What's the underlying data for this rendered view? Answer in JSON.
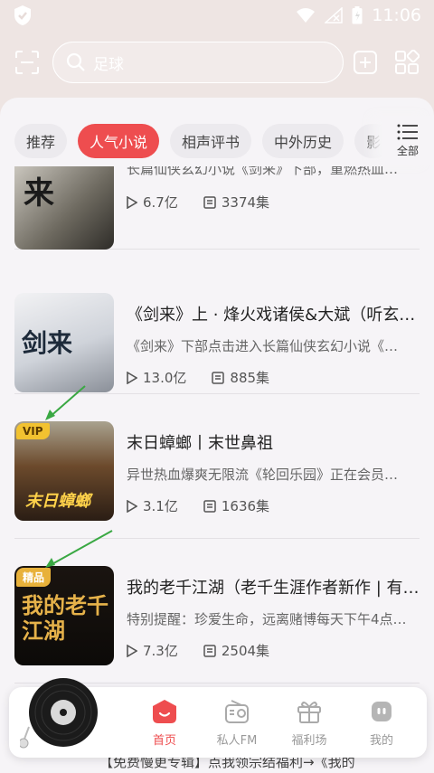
{
  "status": {
    "time": "11:06"
  },
  "search": {
    "placeholder": "足球"
  },
  "tabs": [
    "推荐",
    "人气小说",
    "相声评书",
    "中外历史",
    "影"
  ],
  "tab_all_label": "全部",
  "items": [
    {
      "title": "",
      "desc": "长篇仙侠玄幻小说《剑来》下部，重燃热血…",
      "plays": "6.7亿",
      "episodes": "3374集",
      "cover_text": "来",
      "badge": ""
    },
    {
      "title": "《剑来》上 · 烽火戏诸侯&大斌（听玄…",
      "desc": "《剑来》下部点击进入长篇仙侠玄幻小说《…",
      "plays": "13.0亿",
      "episodes": "885集",
      "cover_text": "剑来",
      "badge": ""
    },
    {
      "title": "末日蟑螂丨末世鼻祖",
      "desc": "异世热血爆爽无限流《轮回乐园》正在会员…",
      "plays": "3.1亿",
      "episodes": "1636集",
      "cover_text": "末日蟑螂",
      "badge": "VIP"
    },
    {
      "title": "我的老千江湖（老千生涯作者新作 | 有…",
      "desc": "特别提醒：珍爱生命，远离赌博每天下午4点…",
      "plays": "7.3亿",
      "episodes": "2504集",
      "cover_text": "我的老千江湖",
      "badge": "精品"
    }
  ],
  "peek_text": "【免费慢更专辑】点我领宗结福利→《我的",
  "nav": [
    {
      "label": "首页"
    },
    {
      "label": "私人FM"
    },
    {
      "label": "福利场"
    },
    {
      "label": "我的"
    }
  ],
  "colors": {
    "accent": "#ee4d4f",
    "vip": "#f2c230"
  }
}
